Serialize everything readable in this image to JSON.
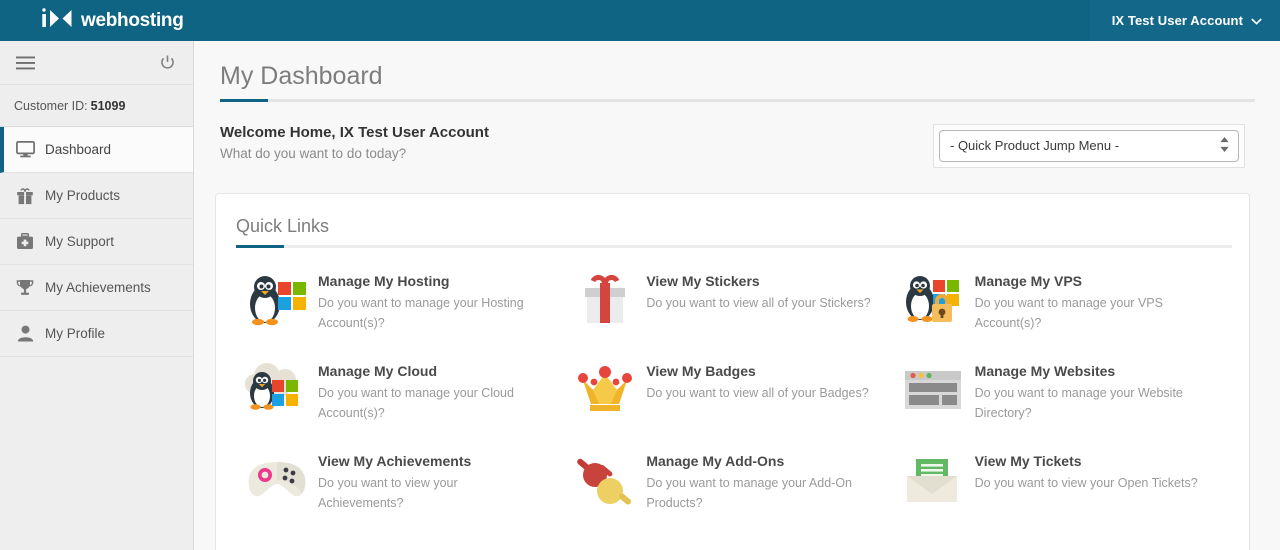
{
  "brand": {
    "logo_text": "webhosting",
    "logo_mark": "ix-logo-icon",
    "header_color": "#0f6383"
  },
  "header": {
    "account_label": "IX Test User Account",
    "account_chevron": "chevron-down-icon"
  },
  "sidebar": {
    "menu_icon": "hamburger-menu-icon",
    "power_icon": "power-icon",
    "customer_id_label": "Customer ID:",
    "customer_id_value": "51099",
    "items": [
      {
        "label": "Dashboard",
        "icon": "monitor-icon",
        "active": true
      },
      {
        "label": "My Products",
        "icon": "gift-icon",
        "active": false
      },
      {
        "label": "My Support",
        "icon": "first-aid-kit-icon",
        "active": false
      },
      {
        "label": "My Achievements",
        "icon": "trophy-icon",
        "active": false
      },
      {
        "label": "My Profile",
        "icon": "person-icon",
        "active": false
      }
    ]
  },
  "page": {
    "title": "My Dashboard",
    "welcome_heading": "Welcome Home, IX Test User Account",
    "welcome_sub": "What do you want to do today?",
    "accent_color": "#0f6383"
  },
  "jump_menu": {
    "selected": "- Quick Product Jump Menu -",
    "stepper_icon": "stepper-arrows-icon"
  },
  "quick_links": {
    "title": "Quick Links",
    "items": [
      {
        "title": "Manage My Hosting",
        "desc": "Do you want to manage your Hosting Account(s)?",
        "icon": "penguin-windows-icon"
      },
      {
        "title": "View My Stickers",
        "desc": "Do you want to view all of your Stickers?",
        "icon": "gift-box-icon"
      },
      {
        "title": "Manage My VPS",
        "desc": "Do you want to manage your VPS Account(s)?",
        "icon": "penguin-windows-lock-icon"
      },
      {
        "title": "Manage My Cloud",
        "desc": "Do you want to manage your Cloud Account(s)?",
        "icon": "penguin-windows-cloud-icon"
      },
      {
        "title": "View My Badges",
        "desc": "Do you want to view all of your Badges?",
        "icon": "crown-icon"
      },
      {
        "title": "Manage My Websites",
        "desc": "Do you want to manage your Website Directory?",
        "icon": "browser-window-icon"
      },
      {
        "title": "View My Achievements",
        "desc": "Do you want to view your Achievements?",
        "icon": "game-controller-icon"
      },
      {
        "title": "Manage My Add-Ons",
        "desc": "Do you want to manage your Add-On Products?",
        "icon": "plug-socket-icon"
      },
      {
        "title": "View My Tickets",
        "desc": "Do you want to view your Open Tickets?",
        "icon": "envelope-letter-icon"
      }
    ]
  }
}
